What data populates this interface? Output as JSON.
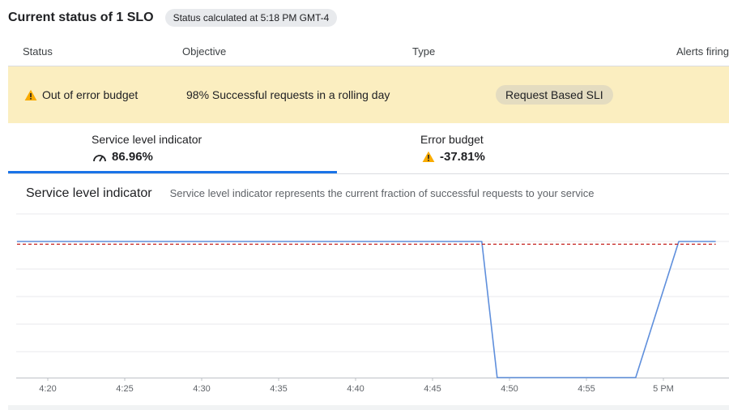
{
  "header": {
    "title": "Current status of 1 SLO",
    "status_chip": "Status calculated at 5:18 PM GMT-4"
  },
  "table": {
    "columns": [
      "Status",
      "Objective",
      "Type",
      "Alerts firing"
    ],
    "row": {
      "status": "Out of error budget",
      "objective": "98% Successful requests in a rolling day",
      "type": "Request Based SLI"
    }
  },
  "tabs": [
    {
      "label": "Service level indicator",
      "value": "86.96%",
      "icon": "gauge-icon",
      "selected": true
    },
    {
      "label": "Error budget",
      "value": "-37.81%",
      "icon": "warning-icon",
      "selected": false
    }
  ],
  "chart_header": {
    "title": "Service level indicator",
    "description": "Service level indicator represents the current fraction of successful requests to your service"
  },
  "colors": {
    "warning": "#f9ab00",
    "row_highlight": "#fbeec0",
    "sli_line": "#5f8fdc",
    "objective_line": "#c5221f",
    "tab_indicator": "#1a73e8"
  },
  "chart_data": {
    "type": "line",
    "x_ticks": [
      "4:20",
      "4:25",
      "4:30",
      "4:35",
      "4:40",
      "4:45",
      "4:50",
      "4:55",
      "5 PM"
    ],
    "x_minutes": [
      0,
      5,
      10,
      15,
      20,
      25,
      30,
      35,
      40
    ],
    "series": [
      {
        "kind": "sli",
        "color": "#5f8fdc",
        "dashed": false,
        "points": [
          [
            -2,
            100
          ],
          [
            28.2,
            100
          ],
          [
            29.2,
            0
          ],
          [
            38.2,
            0
          ],
          [
            41.0,
            100
          ],
          [
            43.4,
            100
          ]
        ]
      },
      {
        "kind": "objective",
        "color": "#c5221f",
        "dashed": true,
        "points": [
          [
            -2,
            98
          ],
          [
            43.4,
            98
          ]
        ]
      }
    ],
    "ylim": [
      0,
      100
    ],
    "grid": true
  }
}
